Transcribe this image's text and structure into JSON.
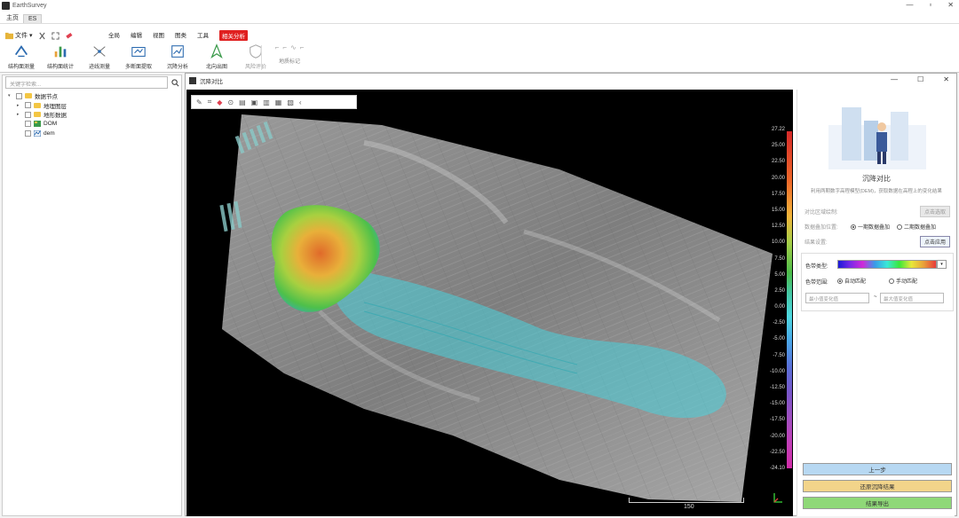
{
  "app": {
    "title": "EarthSurvey"
  },
  "window_controls": [
    "—",
    "▫",
    "✕"
  ],
  "tabs": [
    {
      "label": "主页",
      "active": false
    },
    {
      "label": "ES",
      "active": true
    }
  ],
  "ribbon": {
    "file_label": "文件",
    "menus": [
      "全局",
      "编辑",
      "视图",
      "图类",
      "工具",
      "相关分析"
    ],
    "tools": [
      {
        "label": "结构面测量",
        "icon": "structure-measure-icon"
      },
      {
        "label": "结构面统计",
        "icon": "structure-stats-icon"
      },
      {
        "label": "迹线测量",
        "icon": "trace-measure-icon"
      },
      {
        "label": "多断面提取",
        "icon": "multi-section-icon"
      },
      {
        "label": "沉降分析",
        "icon": "settlement-icon"
      },
      {
        "label": "北向出图",
        "icon": "north-export-icon"
      },
      {
        "label": "风险评价",
        "icon": "risk-assess-icon",
        "disabled": true
      }
    ],
    "mark_group_label": "地质标记"
  },
  "layers": {
    "search_placeholder": "关键字检索...",
    "items": [
      {
        "label": "数据节点",
        "level": 0,
        "arrow": "▾",
        "kind": "folder"
      },
      {
        "label": "地理图层",
        "level": 1,
        "arrow": "▸",
        "kind": "folder"
      },
      {
        "label": "地形数据",
        "level": 1,
        "arrow": "▸",
        "kind": "folder"
      },
      {
        "label": "DOM",
        "level": 1,
        "arrow": "",
        "kind": "dom"
      },
      {
        "label": "dem",
        "level": 1,
        "arrow": "",
        "kind": "dem"
      }
    ]
  },
  "document": {
    "title": "沉降对比",
    "controls": [
      "—",
      "☐",
      "✕"
    ]
  },
  "colorbar": {
    "labels": [
      "27.22",
      "25.00",
      "22.50",
      "20.00",
      "17.50",
      "15.00",
      "12.50",
      "10.00",
      "7.50",
      "5.00",
      "2.50",
      "0.00",
      "-2.50",
      "-5.00",
      "-7.50",
      "-10.00",
      "-12.50",
      "-15.00",
      "-17.50",
      "-20.00",
      "-22.50",
      "-24.10"
    ]
  },
  "scale": {
    "label": "150"
  },
  "panel": {
    "title": "沉降对比",
    "description": "利用两期数字高程模型(DEM)，获取数据在高程上的变化结果",
    "compare_region_label": "对比区域绘制:",
    "compare_region_button": "点击选取",
    "overlay_label": "数据叠加位置:",
    "overlay_options": [
      "一期数据叠加",
      "二期数据叠加"
    ],
    "overlay_selected": 0,
    "result_label": "结果设置:",
    "result_button": "点击应用",
    "colormap_label": "色带类型:",
    "colormode_label": "色带范围:",
    "colormode_options": [
      "自动匹配",
      "手动匹配"
    ],
    "colormode_selected": 0,
    "min_placeholder": "最小值变化值",
    "max_placeholder": "最大值变化值",
    "range_sep": "~",
    "buttons": [
      {
        "label": "上一步",
        "color": "#b7d8f2"
      },
      {
        "label": "还原沉降结果",
        "color": "#f2d48a"
      },
      {
        "label": "结果导出",
        "color": "#8fd878"
      }
    ]
  }
}
